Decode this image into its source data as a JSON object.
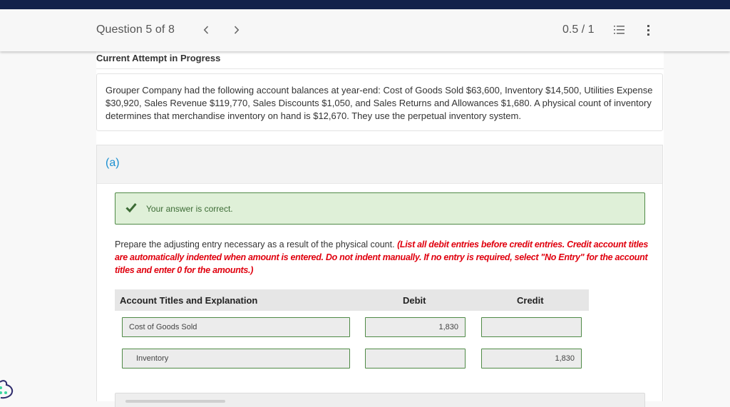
{
  "header": {
    "question_label": "Question 5 of 8",
    "prev_icon": "chevron-left-icon",
    "next_icon": "chevron-right-icon",
    "score": "0.5 / 1",
    "list_icon": "numbered-list-icon",
    "more_icon": "more-vertical-icon"
  },
  "attempt_status": "Current Attempt in Progress",
  "problem_text": "Grouper Company had the following account balances at year-end: Cost of Goods Sold $63,600, Inventory $14,500, Utilities Expense $30,920, Sales Revenue $119,770, Sales Discounts $1,050, and Sales Returns and Allowances $1,680. A physical count of inventory determines that merchandise inventory on hand is $12,670. They use the perpetual inventory system.",
  "part": {
    "label": "(a)",
    "feedback": {
      "icon": "checkmark-icon",
      "text": "Your answer is correct.",
      "color": "#3c6b35"
    },
    "instruction": "Prepare the adjusting entry necessary as a result of the physical count.",
    "instruction_note": "(List all debit entries before credit entries. Credit account titles are automatically indented when amount is entered. Do not indent manually. If no entry is required, select \"No Entry\" for the account titles and enter 0 for the amounts.)",
    "table": {
      "headers": {
        "account": "Account Titles and Explanation",
        "debit": "Debit",
        "credit": "Credit"
      },
      "rows": [
        {
          "account": "Cost of Goods Sold",
          "debit": "1,830",
          "credit": ""
        },
        {
          "account": "Inventory",
          "debit": "",
          "credit": "1,830"
        }
      ]
    }
  },
  "colors": {
    "topbar": "#13214a",
    "part_label": "#1a8fd1",
    "note_red": "#e0000e",
    "success_bg": "#dff0d8",
    "success_border": "#4f8a46"
  },
  "helper_icon": "chat-helper-icon"
}
